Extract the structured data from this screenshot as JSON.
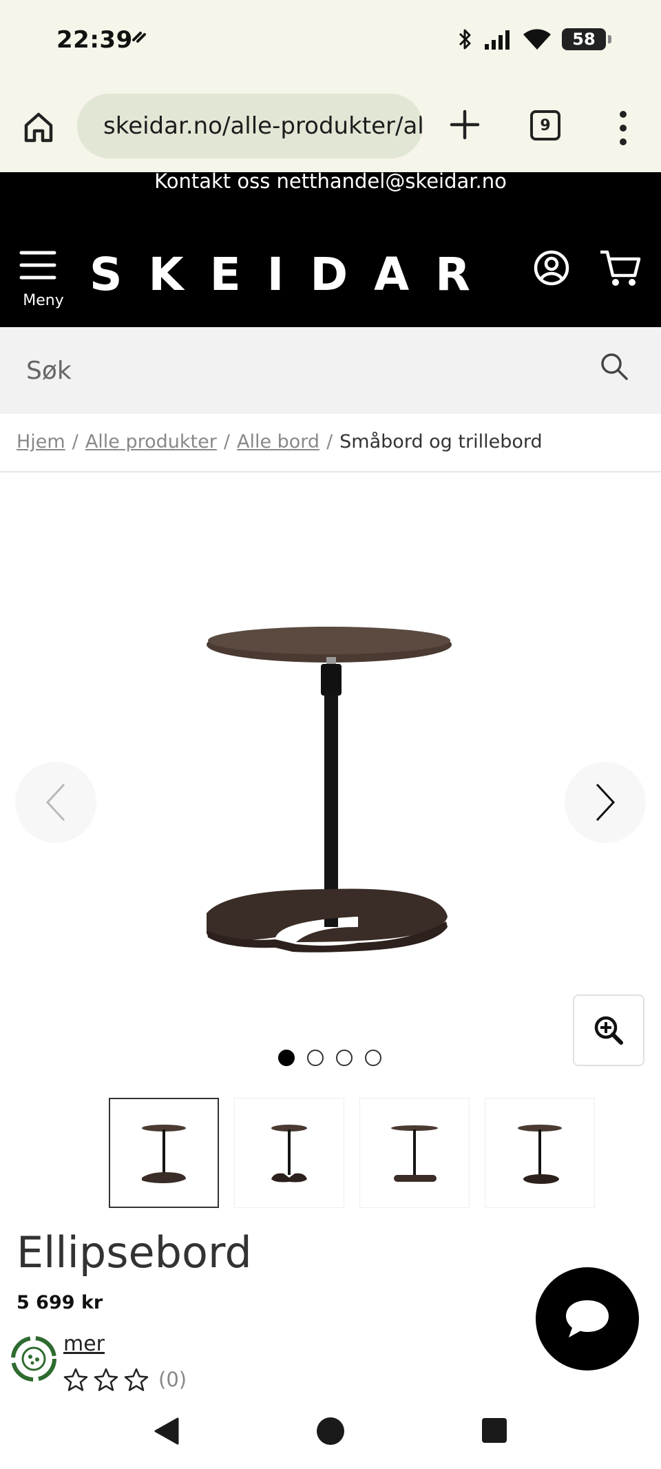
{
  "status_bar": {
    "time": "22:39",
    "battery": "58"
  },
  "browser": {
    "url": "skeidar.no/alle-produkter/alle-bord/smabord-og-trillebord",
    "tab_count": "9"
  },
  "site": {
    "banner": "Kontakt oss netthandel@skeidar.no",
    "logo": "SKEIDAR",
    "menu_label": "Meny",
    "search_placeholder": "Søk"
  },
  "breadcrumb": [
    {
      "label": "Hjem"
    },
    {
      "label": "Alle produkter"
    },
    {
      "label": "Alle bord"
    },
    {
      "label": "Småbord og trillebord"
    }
  ],
  "gallery": {
    "dots": 4,
    "active_dot": 1,
    "thumbnails": 4
  },
  "product": {
    "title": "Ellipsebord",
    "price": "5 699 kr",
    "more_link": "mer",
    "rating_count": "(0)",
    "stars": 0
  },
  "colors": {
    "header_bg": "#000000",
    "browser_bg": "#f5f5e9",
    "url_bg": "#e2e6d5",
    "wood": "#4a3a32"
  },
  "icons": [
    "home-icon",
    "site-settings-icon",
    "plus-icon",
    "tabs-icon",
    "more-vert-icon",
    "hamburger-icon",
    "account-icon",
    "cart-icon",
    "search-icon",
    "chevron-left-icon",
    "chevron-right-icon",
    "zoom-in-icon",
    "star-icon",
    "chat-icon",
    "eco-badge-icon"
  ]
}
